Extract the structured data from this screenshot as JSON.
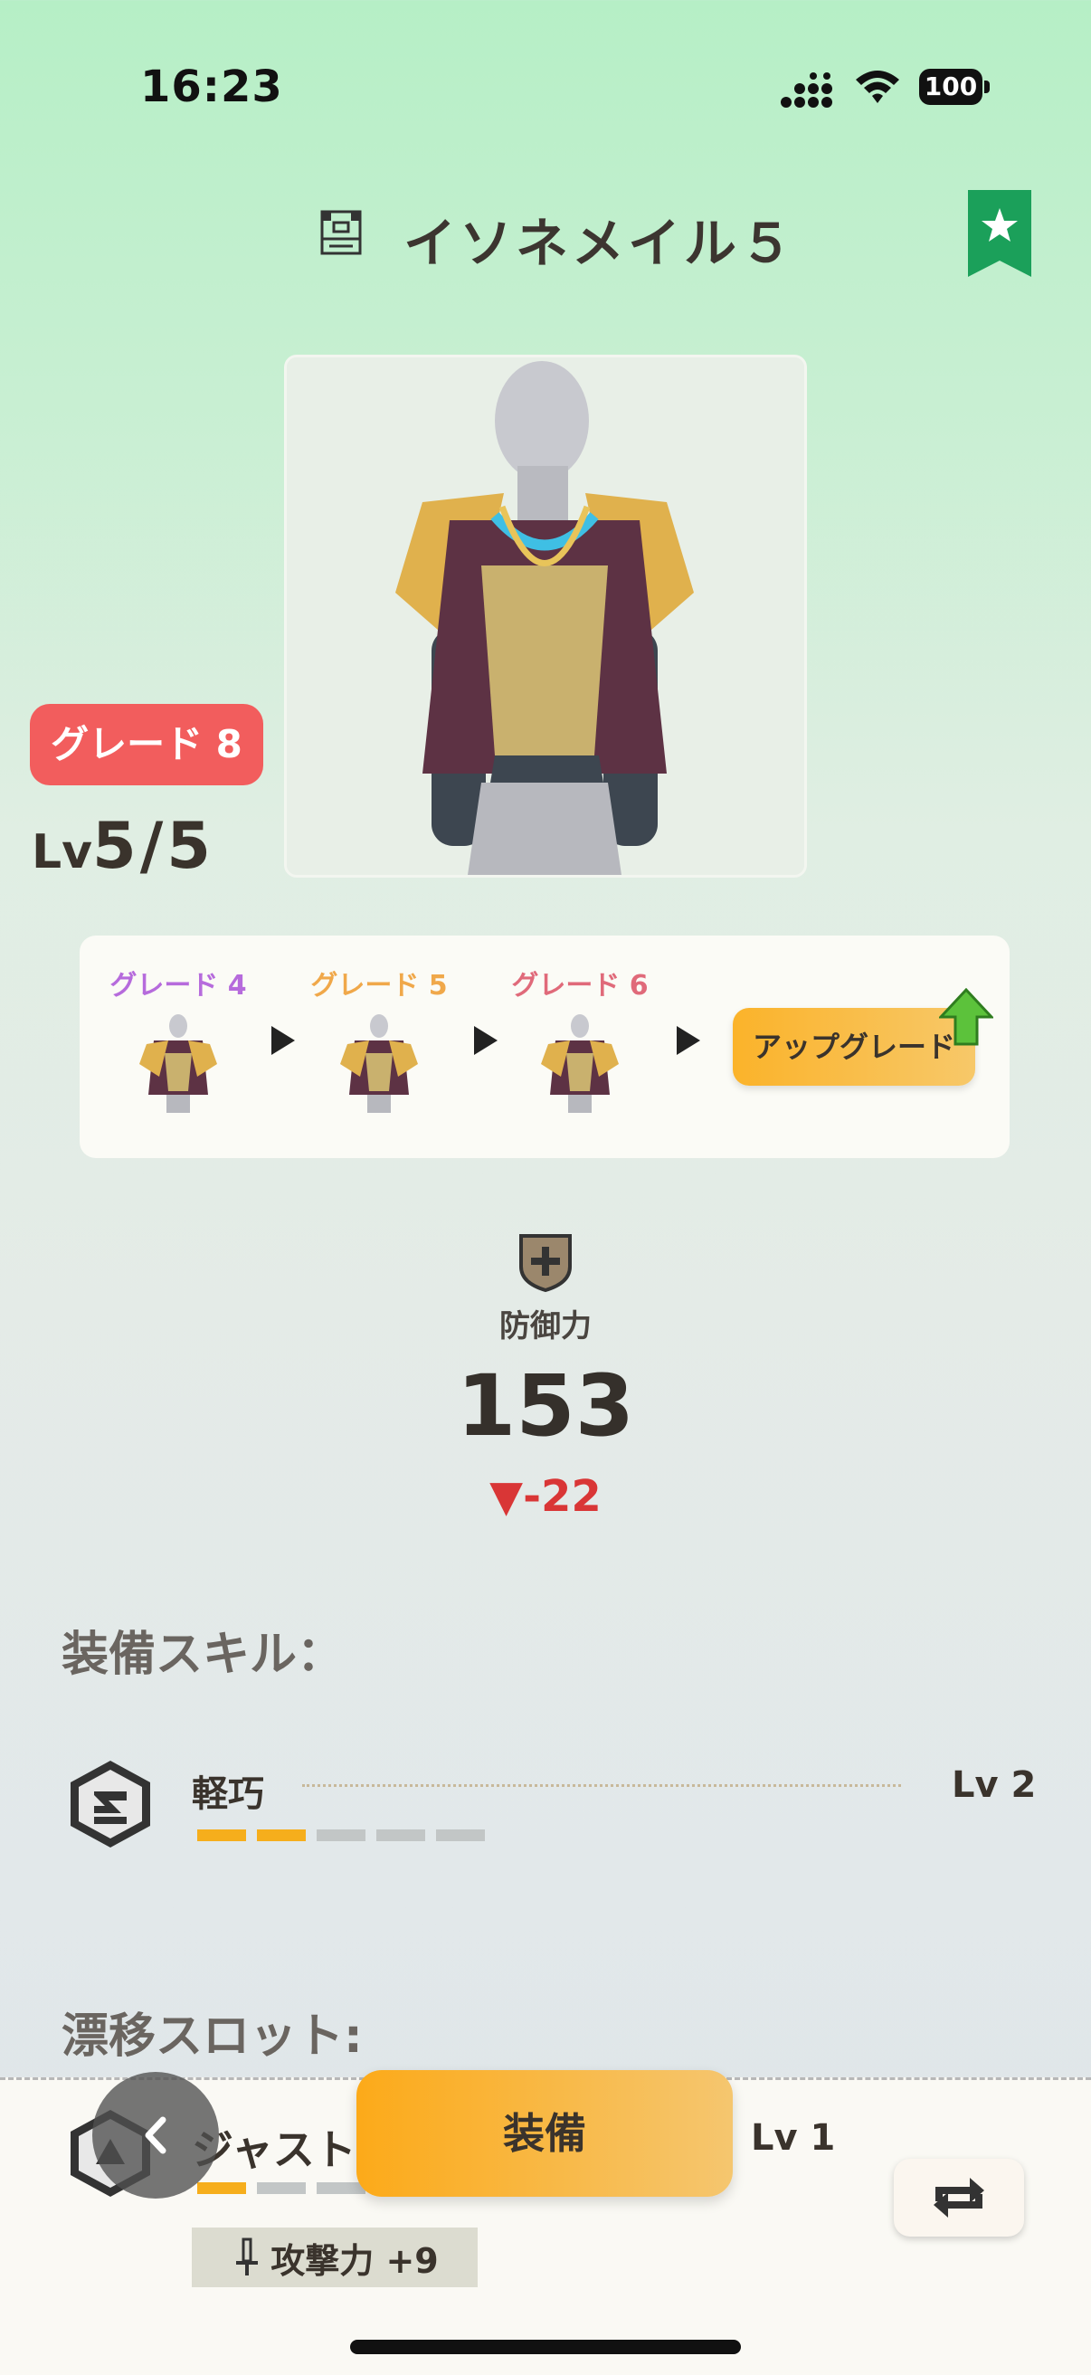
{
  "status_bar": {
    "time": "16:23",
    "battery": "100"
  },
  "header": {
    "title": "イソネメイル５",
    "header_icon": "armor-icon",
    "bookmark_icon": "star-bookmark-icon"
  },
  "equipment": {
    "grade_badge": "グレード 8",
    "level_prefix": "Lv",
    "level_value": "5/5"
  },
  "upgrade_path": {
    "steps": [
      {
        "label": "グレード 4",
        "color": "#b66bdc"
      },
      {
        "label": "グレード 5",
        "color": "#f0a84a"
      },
      {
        "label": "グレード 6",
        "color": "#e06a7a"
      }
    ],
    "button_label": "アップグレード"
  },
  "defense": {
    "label": "防御力",
    "value": "153",
    "delta": "▼-22"
  },
  "skills": {
    "title": "装備スキル：",
    "items": [
      {
        "name": "軽巧",
        "level": "Lv 2",
        "filled": 2,
        "max": 5
      }
    ]
  },
  "drift_slots": {
    "title": "漂移スロット:",
    "items": [
      {
        "name": "ジャスト:",
        "level": "Lv 1",
        "filled": 1,
        "max": 5,
        "bonus": "攻撃力 +9"
      }
    ]
  },
  "actions": {
    "equip_label": "装備"
  },
  "colors": {
    "accent_orange": "#f6ae1c",
    "grade_badge_red": "#f25d5d",
    "bookmark_green": "#1ba05a",
    "delta_red": "#d93636"
  }
}
